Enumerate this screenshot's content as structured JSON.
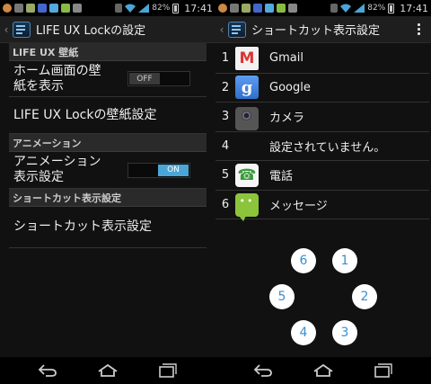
{
  "status_bar": {
    "battery_percent": "82%",
    "time": "17:41",
    "icons": [
      "chrome-icon",
      "pe-icon",
      "app-icon",
      "facebook-icon",
      "twitter-icon",
      "android-icon",
      "lock-icon",
      "usb-icon",
      "wifi-icon",
      "signal-icon"
    ]
  },
  "left": {
    "title": "LIFE UX Lockの設定",
    "sections": [
      {
        "header": "LIFE UX 壁紙",
        "rows": [
          {
            "label": "ホーム画面の壁\n紙を表示",
            "toggle": "OFF"
          },
          {
            "label": "LIFE UX Lockの壁紙設定"
          }
        ]
      },
      {
        "header": "アニメーション",
        "rows": [
          {
            "label": "アニメーション\n表示設定",
            "toggle": "ON"
          }
        ]
      },
      {
        "header": "ショートカット表示設定",
        "rows": [
          {
            "label": "ショートカット表示設定"
          }
        ]
      }
    ]
  },
  "right": {
    "title": "ショートカット表示設定",
    "items": [
      {
        "num": "1",
        "icon": "gmail-icon",
        "name": "Gmail"
      },
      {
        "num": "2",
        "icon": "google-icon",
        "name": "Google"
      },
      {
        "num": "3",
        "icon": "camera-icon",
        "name": "カメラ"
      },
      {
        "num": "4",
        "icon": "",
        "name": "設定されていません。"
      },
      {
        "num": "5",
        "icon": "phone-icon",
        "name": "電話"
      },
      {
        "num": "6",
        "icon": "message-icon",
        "name": "メッセージ"
      }
    ],
    "ring": [
      "1",
      "2",
      "3",
      "4",
      "5",
      "6"
    ]
  },
  "colors": {
    "accent": "#4aa6d6",
    "ring_number": "#3a8fd0",
    "background": "#111111"
  }
}
